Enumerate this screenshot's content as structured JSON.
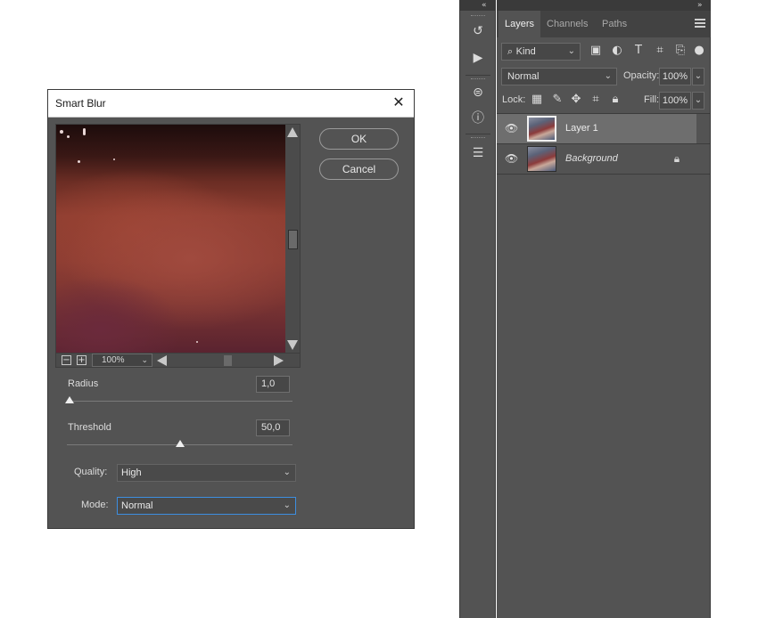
{
  "dialog": {
    "title": "Smart Blur",
    "ok_label": "OK",
    "cancel_label": "Cancel",
    "zoom": "100%",
    "radius_label": "Radius",
    "radius_value": "1,0",
    "radius_level": 0.01,
    "threshold_label": "Threshold",
    "threshold_value": "50,0",
    "threshold_level": 0.5,
    "quality_label": "Quality:",
    "quality_value": "High",
    "mode_label": "Mode:",
    "mode_value": "Normal"
  },
  "toolstrip": {
    "icons": [
      "history-icon",
      "play-actions-icon",
      "properties-icon",
      "info-icon",
      "layer-comps-icon"
    ]
  },
  "layers_panel": {
    "tabs": [
      "Layers",
      "Channels",
      "Paths"
    ],
    "active_tab": "Layers",
    "filter_kind": "Kind",
    "blend_mode": "Normal",
    "opacity_label": "Opacity:",
    "opacity_value": "100%",
    "lock_label": "Lock:",
    "fill_label": "Fill:",
    "fill_value": "100%",
    "layers": [
      {
        "name": "Layer 1",
        "selected": true,
        "locked": false,
        "visible": true
      },
      {
        "name": "Background",
        "selected": false,
        "locked": true,
        "visible": true
      }
    ]
  },
  "colors": {
    "panel_bg": "#535353",
    "dark_bar": "#3a3a3a",
    "selected_layer": "#6e6e6e",
    "focus_border": "#3d8ee0"
  }
}
